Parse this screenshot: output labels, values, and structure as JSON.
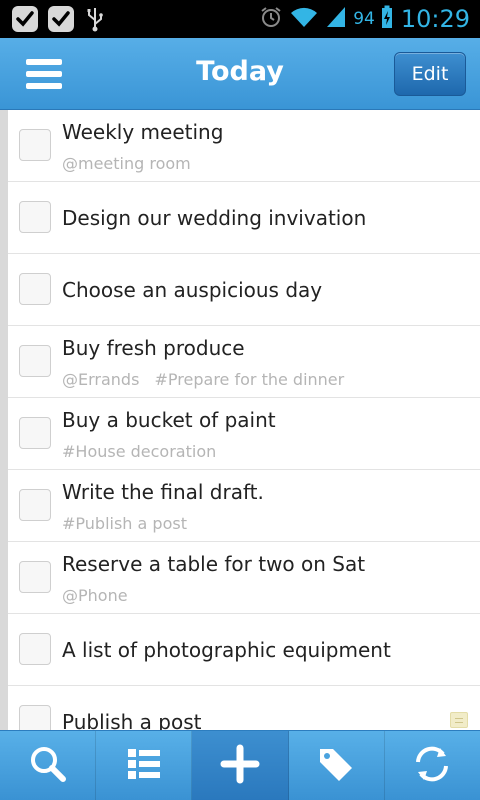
{
  "status_bar": {
    "battery": "94",
    "time": "10:29",
    "icons": [
      "check-icon",
      "check-icon",
      "usb-icon",
      "alarm-icon",
      "wifi-icon",
      "signal-icon",
      "battery-charging-icon"
    ]
  },
  "header": {
    "title": "Today",
    "edit_label": "Edit",
    "menu_icon": "menu-icon"
  },
  "tasks": [
    {
      "title": "Weekly meeting",
      "tags": [
        "@meeting room"
      ]
    },
    {
      "title": "Design our wedding invivation",
      "tags": []
    },
    {
      "title": "Choose an auspicious day",
      "tags": []
    },
    {
      "title": "Buy fresh produce",
      "tags": [
        "@Errands",
        "#Prepare for the dinner"
      ]
    },
    {
      "title": "Buy a bucket of paint",
      "tags": [
        "#House decoration"
      ]
    },
    {
      "title": "Write the final draft.",
      "tags": [
        "#Publish a post"
      ]
    },
    {
      "title": "Reserve a table for two on Sat",
      "tags": [
        "@Phone"
      ]
    },
    {
      "title": "A list of photographic equipment",
      "tags": []
    },
    {
      "title": "Publish a post",
      "tags": [],
      "has_note": true
    }
  ],
  "toolbar": {
    "buttons": [
      "search-icon",
      "list-icon",
      "add-icon",
      "tag-icon",
      "sync-icon"
    ]
  },
  "colors": {
    "accent": "#3a95d6",
    "status_text": "#33b5e5"
  }
}
